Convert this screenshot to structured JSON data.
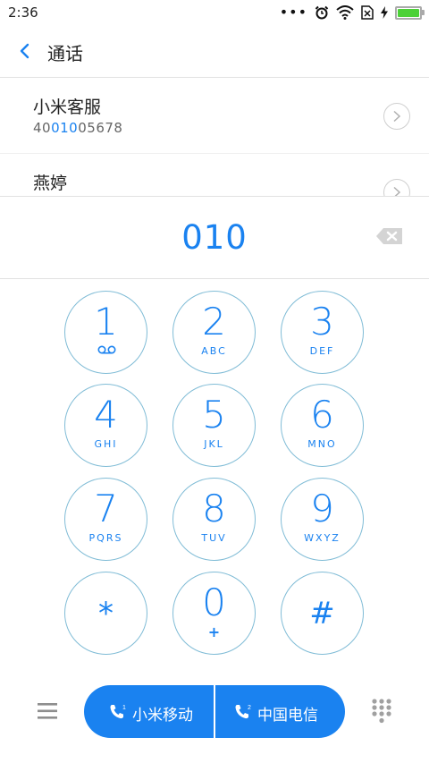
{
  "status_bar": {
    "time": "2:36",
    "icons": [
      "more-dots-icon",
      "alarm-icon",
      "wifi-icon",
      "no-sim-icon",
      "charging-bolt-icon",
      "battery-icon"
    ],
    "battery_color": "#4cd137"
  },
  "header": {
    "title": "通话"
  },
  "contacts": [
    {
      "name": "小米客服",
      "number_pre": "40",
      "number_match": "010",
      "number_post": "05678"
    },
    {
      "name": "燕婷",
      "number_pre": "",
      "number_match": "",
      "number_post": ""
    }
  ],
  "display": {
    "number": "010"
  },
  "keypad": [
    {
      "digit": "1",
      "letters": ""
    },
    {
      "digit": "2",
      "letters": "ABC"
    },
    {
      "digit": "3",
      "letters": "DEF"
    },
    {
      "digit": "4",
      "letters": "GHI"
    },
    {
      "digit": "5",
      "letters": "JKL"
    },
    {
      "digit": "6",
      "letters": "MNO"
    },
    {
      "digit": "7",
      "letters": "PQRS"
    },
    {
      "digit": "8",
      "letters": "TUV"
    },
    {
      "digit": "9",
      "letters": "WXYZ"
    },
    {
      "digit": "*",
      "letters": ""
    },
    {
      "digit": "0",
      "letters": "+"
    },
    {
      "digit": "#",
      "letters": ""
    }
  ],
  "call": {
    "sim1_label": "小米移动",
    "sim2_label": "中国电信",
    "sim1_badge": "1",
    "sim2_badge": "2",
    "accent": "#1a82f0"
  }
}
